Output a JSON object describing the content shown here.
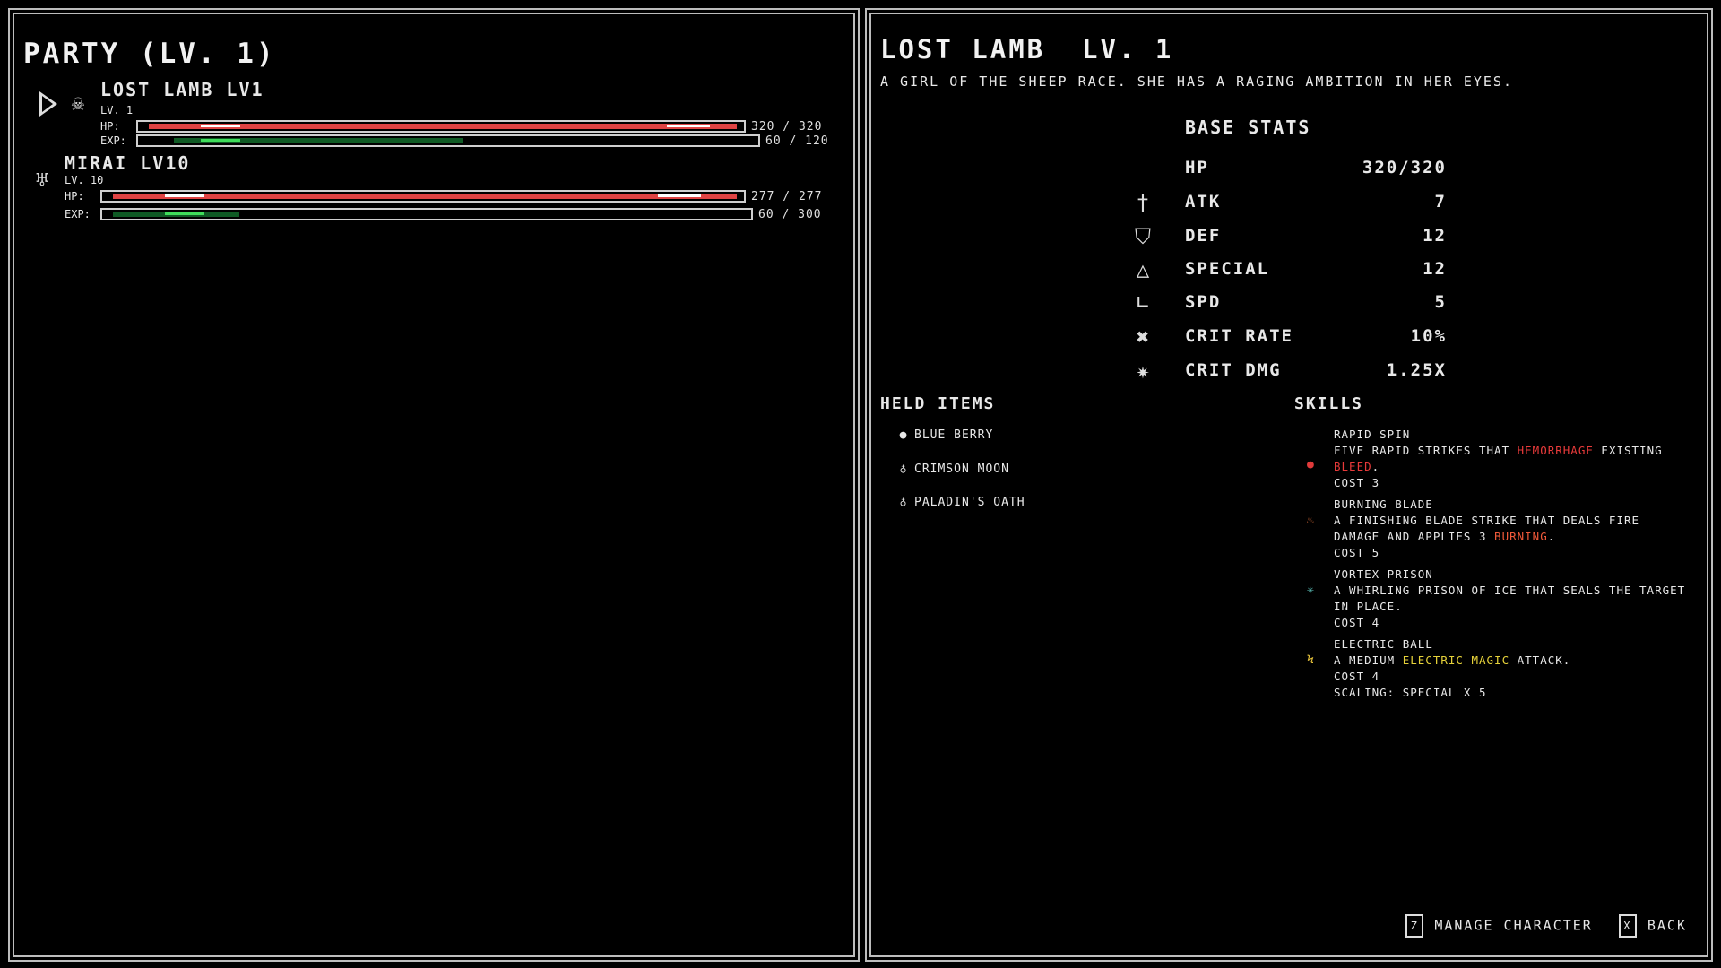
{
  "party": {
    "title": "PARTY (LV. 1)",
    "members": [
      {
        "name": "LOST LAMB LV1",
        "level_text": "LV. 1",
        "hp_label": "HP:",
        "exp_label": "EXP:",
        "hp_text": "320 / 320",
        "exp_text": "60 / 120",
        "hp_fraction": 1.0,
        "exp_fraction": 0.5,
        "avatar_icon": "sheep-icon",
        "selected": true
      },
      {
        "name": "MIRAI LV10",
        "level_text": "LV. 10",
        "hp_label": "HP:",
        "exp_label": "EXP:",
        "hp_text": "277 / 277",
        "exp_text": "60 / 300",
        "hp_fraction": 1.0,
        "exp_fraction": 0.2,
        "avatar_icon": "horned-character-icon",
        "selected": false
      }
    ]
  },
  "character": {
    "title": "LOST LAMB  LV. 1",
    "description": "A GIRL OF THE SHEEP RACE. SHE HAS A RAGING AMBITION IN HER EYES.",
    "base_stats_title": "BASE STATS",
    "stats": [
      {
        "name": "HP",
        "value": "320/320",
        "icon": ""
      },
      {
        "name": "ATK",
        "value": "7",
        "icon": "sword-icon"
      },
      {
        "name": "DEF",
        "value": "12",
        "icon": "shield-icon"
      },
      {
        "name": "SPECIAL",
        "value": "12",
        "icon": "flask-icon"
      },
      {
        "name": "SPD",
        "value": "5",
        "icon": "boot-icon"
      },
      {
        "name": "CRIT RATE",
        "value": "10%",
        "icon": "crossed-swords-icon"
      },
      {
        "name": "CRIT DMG",
        "value": "1.25X",
        "icon": "burst-icon"
      }
    ],
    "held_items_title": "HELD ITEMS",
    "held_items": [
      {
        "name": "BLUE BERRY",
        "icon": "berry-icon"
      },
      {
        "name": "CRIMSON MOON",
        "icon": "pendant-icon"
      },
      {
        "name": "PALADIN'S OATH",
        "icon": "pendant-icon"
      }
    ],
    "skills_title": "SKILLS",
    "skills": [
      {
        "name": "RAPID SPIN",
        "desc_a": "FIVE RAPID STRIKES THAT ",
        "desc_kw1": "HEMORRHAGE",
        "desc_b": " EXISTING ",
        "desc_kw2": "BLEED",
        "desc_c": ".",
        "cost": "COST 3",
        "icon": "blood-drop-icon",
        "icon_color": "#e03a3a"
      },
      {
        "name": "BURNING BLADE",
        "desc_a": "A FINISHING BLADE STRIKE THAT DEALS FIRE DAMAGE AND APPLIES 3 ",
        "desc_kw1": "BURNING",
        "desc_b": ".",
        "cost": "COST 5",
        "icon": "fire-icon",
        "icon_color": "#e0703a"
      },
      {
        "name": "VORTEX PRISON",
        "desc_a": "A WHIRLING PRISON OF ICE THAT SEALS THE TARGET IN PLACE.",
        "cost": "COST 4",
        "icon": "snowflake-icon",
        "icon_color": "#5fc8c0"
      },
      {
        "name": "ELECTRIC BALL",
        "desc_a": "A MEDIUM ",
        "desc_kw1": "ELECTRIC MAGIC",
        "desc_b": " ATTACK.",
        "cost": "COST 4",
        "scaling": "SCALING: SPECIAL X 5",
        "icon": "lightning-icon",
        "icon_color": "#e6c23a"
      }
    ]
  },
  "controls": {
    "manage_key": "Z",
    "manage_label": "MANAGE CHARACTER",
    "back_key": "X",
    "back_label": "BACK"
  }
}
